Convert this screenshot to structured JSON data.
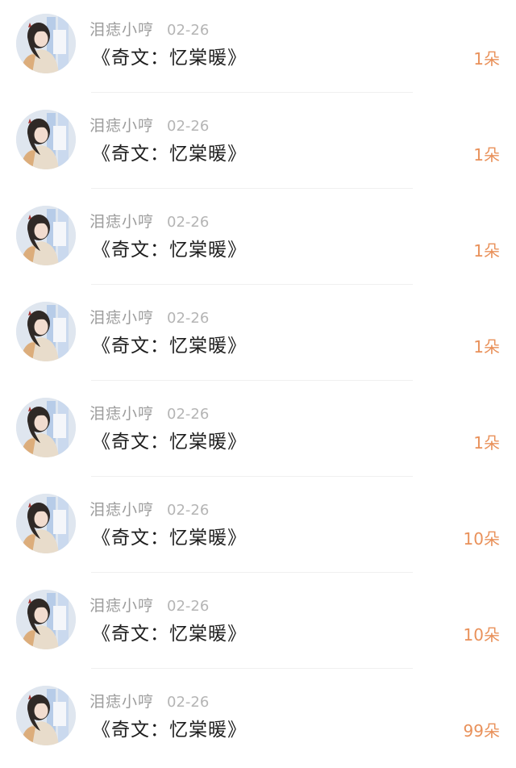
{
  "gifts": [
    {
      "user": "泪痣小哼",
      "date": "02-26",
      "book": "《奇文：忆棠暖》",
      "amount": "1朵",
      "avatar_icon": "user-avatar-icon"
    },
    {
      "user": "泪痣小哼",
      "date": "02-26",
      "book": "《奇文：忆棠暖》",
      "amount": "1朵",
      "avatar_icon": "user-avatar-icon"
    },
    {
      "user": "泪痣小哼",
      "date": "02-26",
      "book": "《奇文：忆棠暖》",
      "amount": "1朵",
      "avatar_icon": "user-avatar-icon"
    },
    {
      "user": "泪痣小哼",
      "date": "02-26",
      "book": "《奇文：忆棠暖》",
      "amount": "1朵",
      "avatar_icon": "user-avatar-icon"
    },
    {
      "user": "泪痣小哼",
      "date": "02-26",
      "book": "《奇文：忆棠暖》",
      "amount": "1朵",
      "avatar_icon": "user-avatar-icon"
    },
    {
      "user": "泪痣小哼",
      "date": "02-26",
      "book": "《奇文：忆棠暖》",
      "amount": "10朵",
      "avatar_icon": "user-avatar-icon"
    },
    {
      "user": "泪痣小哼",
      "date": "02-26",
      "book": "《奇文：忆棠暖》",
      "amount": "10朵",
      "avatar_icon": "user-avatar-icon"
    },
    {
      "user": "泪痣小哼",
      "date": "02-26",
      "book": "《奇文：忆棠暖》",
      "amount": "99朵",
      "avatar_icon": "user-avatar-icon"
    }
  ],
  "colors": {
    "username": "#9c9c9c",
    "date": "#b5b5b5",
    "title": "#1e1e1e",
    "amount": "#e9915a",
    "divider": "#efefef"
  }
}
